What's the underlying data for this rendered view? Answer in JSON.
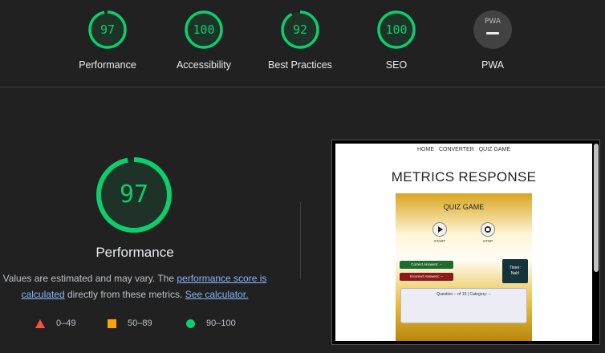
{
  "summary": {
    "gauges": [
      {
        "score": "97",
        "label": "Performance",
        "value": 97
      },
      {
        "score": "100",
        "label": "Accessibility",
        "value": 100
      },
      {
        "score": "92",
        "label": "Best Practices",
        "value": 92
      },
      {
        "score": "100",
        "label": "SEO",
        "value": 100
      }
    ],
    "pwa": {
      "badge_text": "PWA",
      "label": "PWA"
    }
  },
  "main": {
    "score": "97",
    "score_value": 97,
    "label": "Performance",
    "desc_before": "Values are estimated and may vary. The ",
    "desc_link1": "performance score is calculated",
    "desc_middle": " directly from these metrics. ",
    "desc_link2": "See calculator."
  },
  "legend": [
    {
      "range": "0–49",
      "shape": "triangle",
      "color": "#ff4e42"
    },
    {
      "range": "50–89",
      "shape": "square",
      "color": "#ffa400"
    },
    {
      "range": "90–100",
      "shape": "circle",
      "color": "#0cce6b"
    }
  ],
  "screenshot": {
    "nav": [
      "HOME",
      "CONVERTER",
      "QUIZ GAME"
    ],
    "headline": "METRICS RESPONSE",
    "card_title": "QUIZ GAME",
    "start_label": "START",
    "stop_label": "STOP",
    "correct": "Correct Answers: --",
    "incorrect": "Incorrect Answers: --",
    "timer_line1": "Timer:",
    "timer_line2": "Nah!",
    "question": "Question -- of 15 | Category: --"
  },
  "colors": {
    "pass": "#0cce6b",
    "average": "#ffa400",
    "fail": "#ff4e42",
    "link": "#8ab4f8"
  }
}
